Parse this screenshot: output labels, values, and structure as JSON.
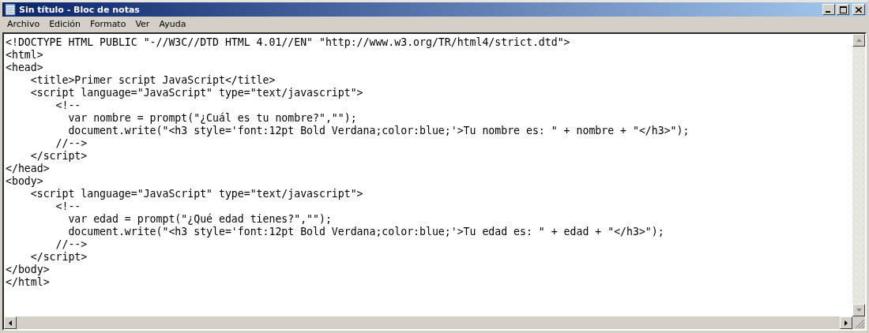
{
  "window": {
    "title": "Sin título - Bloc de notas"
  },
  "menu": [
    "Archivo",
    "Edición",
    "Formato",
    "Ver",
    "Ayuda"
  ],
  "editor": {
    "lines": [
      "<!DOCTYPE HTML PUBLIC \"-//W3C//DTD HTML 4.01//EN\" \"http://www.w3.org/TR/html4/strict.dtd\">",
      "<html>",
      "<head>",
      "    <title>Primer script JavaScript</title>",
      "    <script language=\"JavaScript\" type=\"text/javascript\">",
      "        <!--",
      "          var nombre = prompt(\"¿Cuál es tu nombre?\",\"\");",
      "          document.write(\"<h3 style='font:12pt Bold Verdana;color:blue;'>Tu nombre es: \" + nombre + \"</h3>\");",
      "        //-->",
      "    </script>",
      "</head>",
      "<body>",
      "    <script language=\"JavaScript\" type=\"text/javascript\">",
      "        <!--",
      "          var edad = prompt(\"¿Qué edad tienes?\",\"\");",
      "          document.write(\"<h3 style='font:12pt Bold Verdana;color:blue;'>Tu edad es: \" + edad + \"</h3>\");",
      "        //-->",
      "    </script>",
      "</body>",
      "</html>"
    ]
  }
}
